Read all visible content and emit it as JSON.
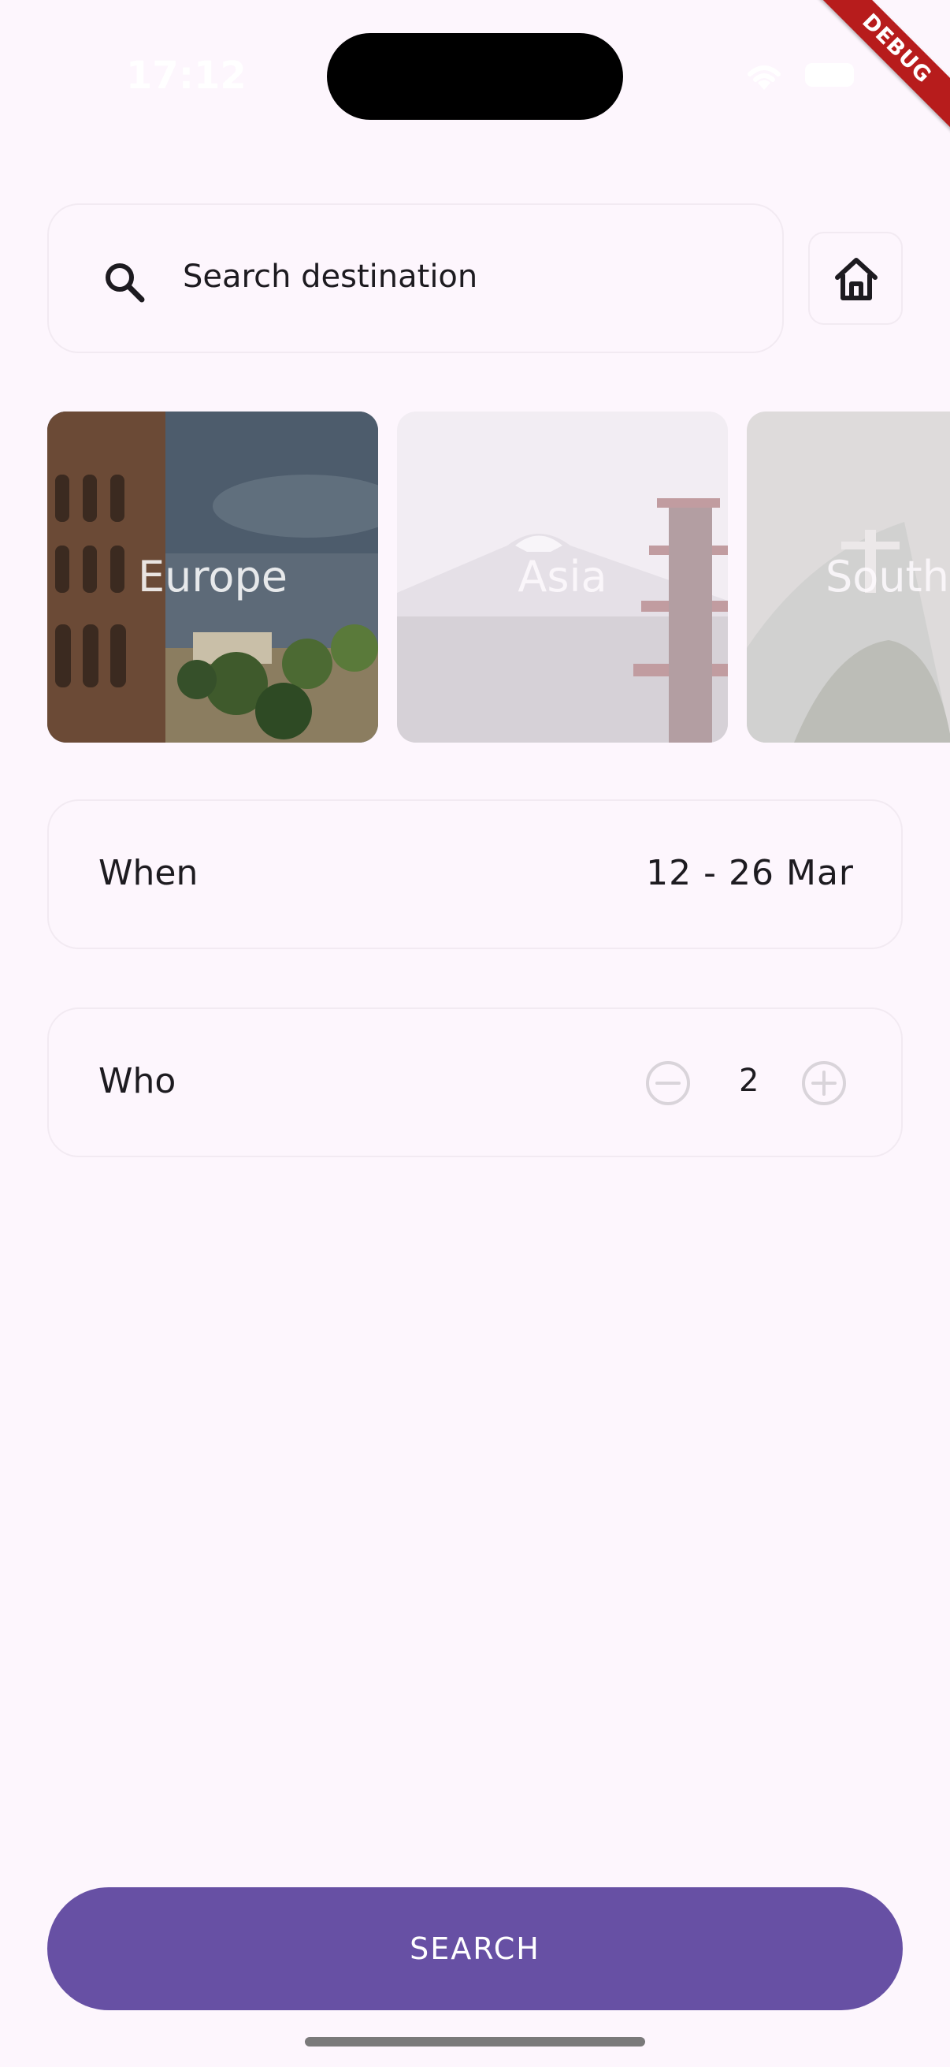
{
  "status_bar": {
    "time": "17:12"
  },
  "debug_banner": "DEBUG",
  "search": {
    "placeholder": "Search destination"
  },
  "destinations": [
    {
      "label": "Europe"
    },
    {
      "label": "Asia"
    },
    {
      "label": "South America"
    }
  ],
  "when": {
    "label": "When",
    "value": "12 - 26 Mar"
  },
  "who": {
    "label": "Who",
    "count": "2"
  },
  "action": {
    "search_label": "SEARCH"
  },
  "colors": {
    "primary": "#6750a4",
    "background": "#fdf6fd",
    "border": "#f2eaf2"
  }
}
